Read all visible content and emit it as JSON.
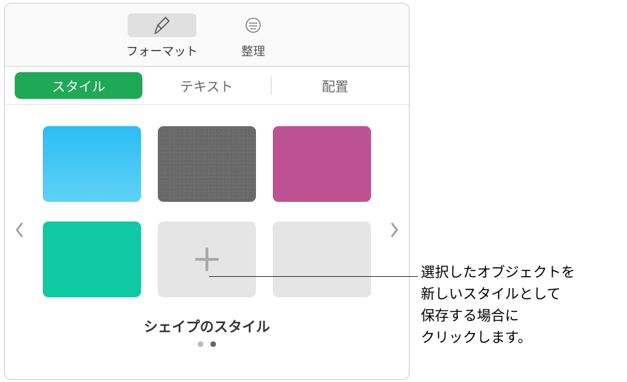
{
  "toolbar": {
    "format": {
      "label": "フォーマット"
    },
    "arrange": {
      "label": "整理"
    }
  },
  "tabs": {
    "style": "スタイル",
    "text": "テキスト",
    "layout": "配置"
  },
  "section": {
    "title": "シェイプのスタイル"
  },
  "callout": {
    "line1": "選択したオブジェクトを",
    "line2": "新しいスタイルとして",
    "line3": "保存する場合に",
    "line4": "クリックします。"
  }
}
